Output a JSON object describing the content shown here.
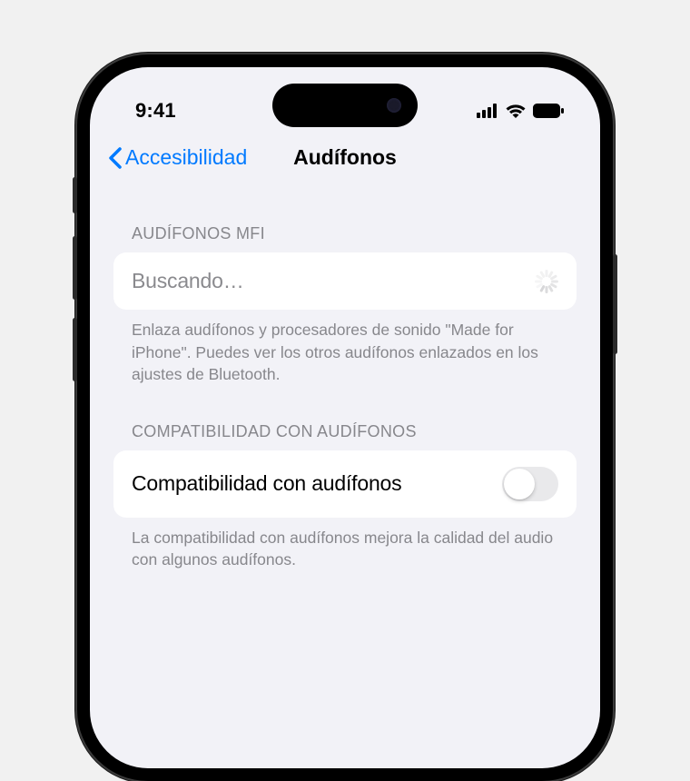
{
  "statusBar": {
    "time": "9:41"
  },
  "nav": {
    "back": "Accesibilidad",
    "title": "Audífonos"
  },
  "sections": {
    "mfi": {
      "header": "AUDÍFONOS MFI",
      "searching": "Buscando…",
      "footer": "Enlaza audífonos y procesadores de sonido \"Made for iPhone\". Puedes ver los otros audífonos enlazados en los ajustes de Bluetooth."
    },
    "compat": {
      "header": "COMPATIBILIDAD CON AUDÍFONOS",
      "label": "Compatibilidad con audífonos",
      "footer": "La compatibilidad con audífonos mejora la calidad del audio con algunos audífonos."
    }
  }
}
